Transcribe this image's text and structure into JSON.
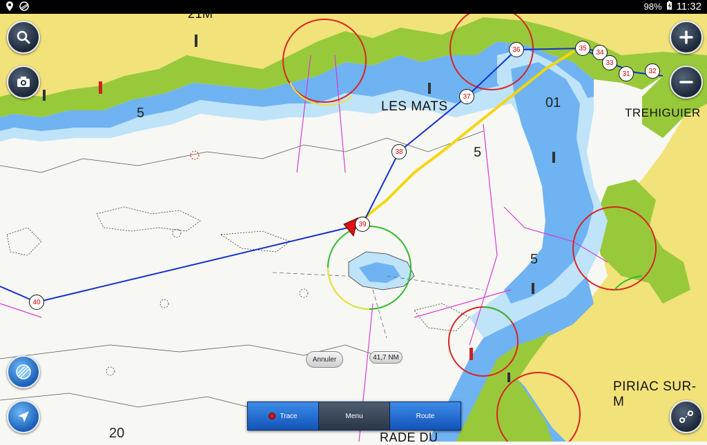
{
  "status_bar": {
    "battery": "98%",
    "time": "11:32"
  },
  "map": {
    "place_labels": {
      "les_mats": "LES MATS",
      "trehiguier": "TREHIGUIER",
      "piriac": "PIRIAC SUR-M",
      "rade_du": "RADE DU",
      "top_label": "21M"
    },
    "depth_labels": [
      "5",
      "5",
      "5",
      "01",
      "20"
    ],
    "waypoints": [
      "31",
      "32",
      "33",
      "34",
      "35",
      "36",
      "37",
      "38",
      "39",
      "40"
    ],
    "distance_badge": "41,7 NM",
    "cancel_button": "Annuler",
    "colors": {
      "land": "#f2e27a",
      "vegetation": "#98c93a",
      "shallow_blue": "#6fb3f2",
      "light_blue": "#bfe3f9",
      "route_line": "#1030d0",
      "track_line": "#f5d60a"
    }
  },
  "controls": {
    "zoom_in_icon": "plus-icon",
    "zoom_out_icon": "minus-icon",
    "search_icon": "search-icon",
    "camera_icon": "camera-icon",
    "layers_icon": "layers-icon",
    "locate_icon": "navigation-arrow-icon",
    "route_tools_icon": "route-tools-icon"
  },
  "bottom_bar": {
    "trace_label": "Trace",
    "menu_label": "Menu",
    "route_label": "Route"
  }
}
